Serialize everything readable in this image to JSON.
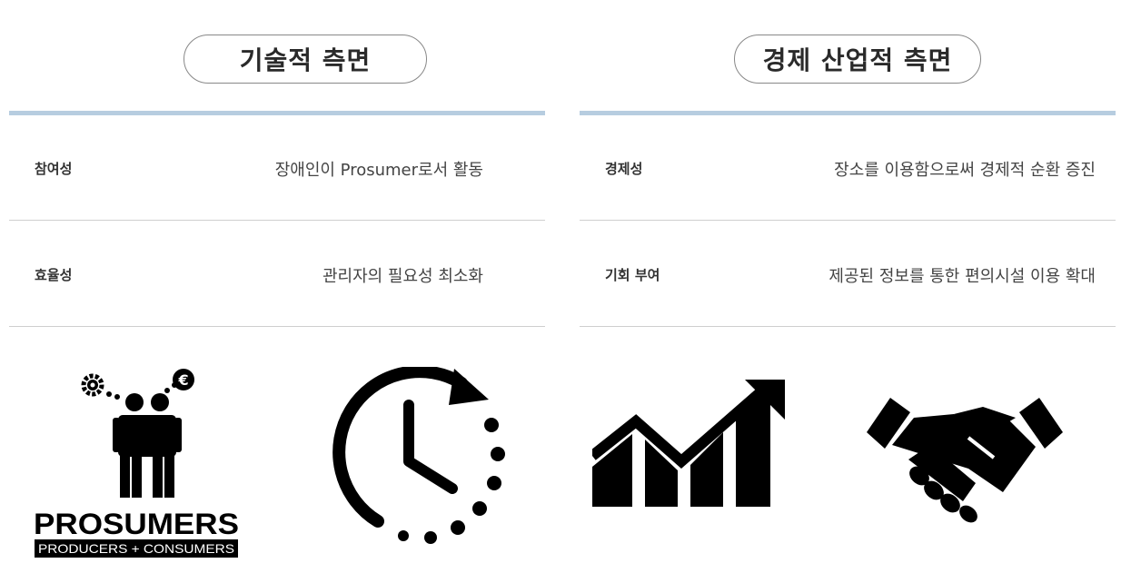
{
  "left": {
    "heading": "기술적 측면",
    "rows": [
      {
        "label": "참여성",
        "desc": "장애인이 Prosumer로서 활동"
      },
      {
        "label": "효율성",
        "desc": "관리자의 필요성 최소화"
      }
    ],
    "prosumers": {
      "title": "PROSUMERS",
      "subtitle": "PRODUCERS + CONSUMERS",
      "currency": "€"
    }
  },
  "right": {
    "heading": "경제 산업적 측면",
    "rows": [
      {
        "label": "경제성",
        "desc": "장소를 이용함으로써 경제적 순환 증진"
      },
      {
        "label": "기회 부여",
        "desc": "제공된 정보를 통한 편의시설 이용 확대"
      }
    ]
  },
  "icons": [
    "prosumers-icon",
    "clock-refresh-icon",
    "growth-chart-icon",
    "handshake-icon"
  ],
  "colors": {
    "accent_line": "#b7cde0",
    "divider": "#cfcfcf",
    "icon": "#000000"
  }
}
